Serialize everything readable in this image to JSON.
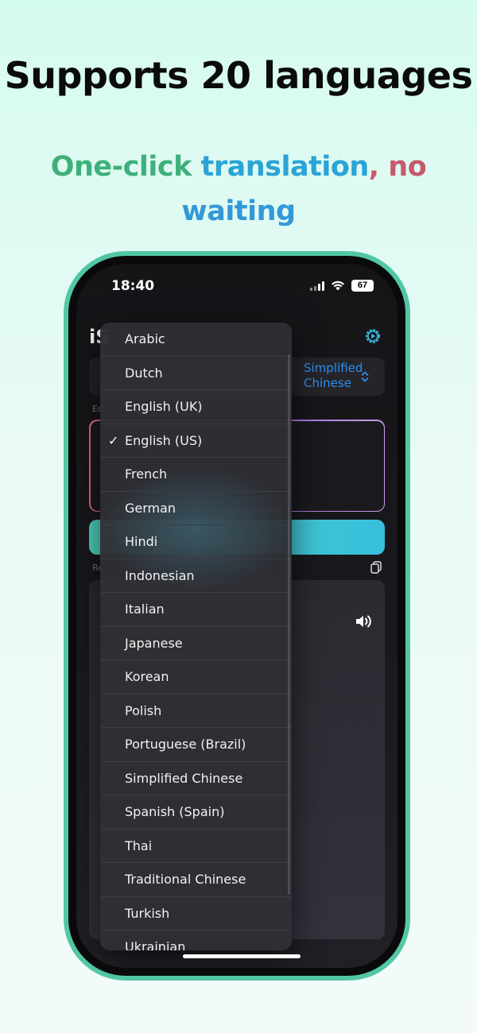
{
  "headline": "Supports 20 languages",
  "subline": {
    "part1": "One-click ",
    "part2": "translation",
    "part3": ", no",
    "part4": "waiting"
  },
  "status_bar": {
    "time": "18:40",
    "battery": "67"
  },
  "app": {
    "title": "iS",
    "target_language": "Simplified Chinese",
    "input_label": "En",
    "result_label": "Re"
  },
  "language_menu": {
    "selected": "English (US)",
    "items": [
      "Arabic",
      "Dutch",
      "English (UK)",
      "English (US)",
      "French",
      "German",
      "Hindi",
      "Indonesian",
      "Italian",
      "Japanese",
      "Korean",
      "Polish",
      "Portuguese (Brazil)",
      "Simplified Chinese",
      "Spanish (Spain)",
      "Thai",
      "Traditional Chinese",
      "Turkish",
      "Ukrainian"
    ]
  },
  "colors": {
    "phone_frame": "#52c7a6",
    "accent_blue": "#2b8ff2",
    "button_gradient_start": "#4fd3c0",
    "button_gradient_end": "#38c0dc"
  }
}
